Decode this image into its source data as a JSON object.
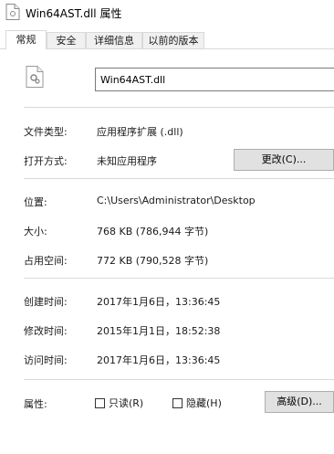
{
  "window": {
    "title": "Win64AST.dll 属性"
  },
  "tabs": [
    {
      "label": "常规",
      "active": true
    },
    {
      "label": "安全",
      "active": false
    },
    {
      "label": "详细信息",
      "active": false
    },
    {
      "label": "以前的版本",
      "active": false
    }
  ],
  "file": {
    "name": "Win64AST.dll",
    "icon": "dll-file-icon"
  },
  "type": {
    "label": "文件类型:",
    "value": "应用程序扩展 (.dll)"
  },
  "opens_with": {
    "label": "打开方式:",
    "value": "未知应用程序",
    "change_button": "更改(C)..."
  },
  "location": {
    "label": "位置:",
    "value": "C:\\Users\\Administrator\\Desktop"
  },
  "size": {
    "label": "大小:",
    "value": "768 KB (786,944 字节)"
  },
  "size_on_disk": {
    "label": "占用空间:",
    "value": "772 KB (790,528 字节)"
  },
  "created": {
    "label": "创建时间:",
    "value": "2017年1月6日，13:36:45"
  },
  "modified": {
    "label": "修改时间:",
    "value": "2015年1月1日，18:52:38"
  },
  "accessed": {
    "label": "访问时间:",
    "value": "2017年1月6日，13:36:45"
  },
  "attributes": {
    "label": "属性:",
    "readonly": {
      "label": "只读(R)",
      "checked": false
    },
    "hidden": {
      "label": "隐藏(H)",
      "checked": false
    },
    "advanced_button": "高级(D)..."
  }
}
